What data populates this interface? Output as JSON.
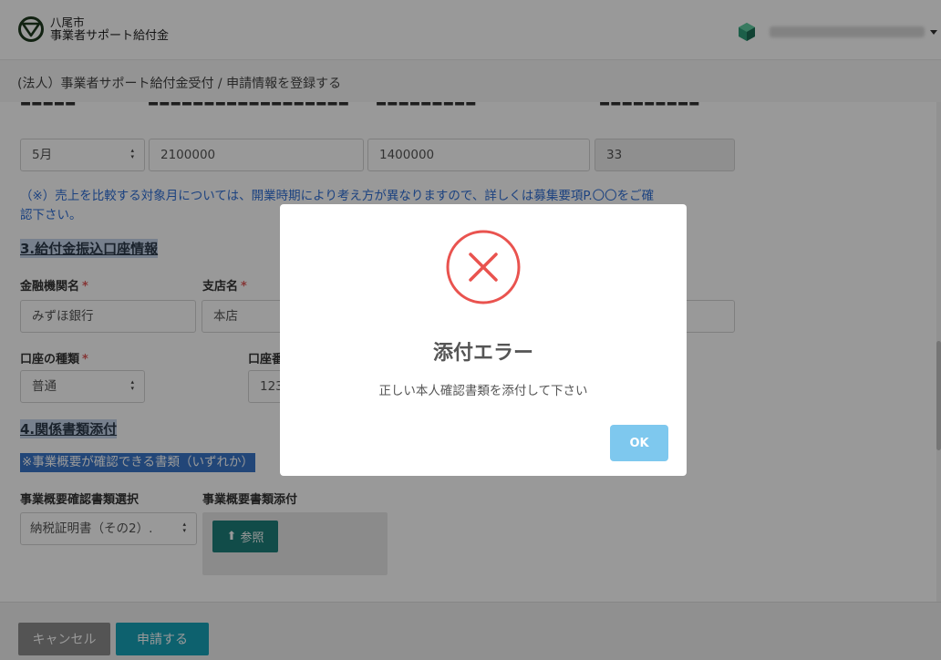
{
  "header": {
    "logo_line1": "八尾市",
    "logo_line2": "事業者サポート給付金"
  },
  "breadcrumb": "(法人）事業者サポート給付金受付 / 申請情報を登録する",
  "sales": {
    "month": "5月",
    "prior_sales": "2100000",
    "current_sales": "1400000",
    "decrease_rate": "33"
  },
  "note1_line1": "（※）売上を比較する対象月については、開業時期により考え方が異なりますので、詳しくは募集要項P.〇〇をご確",
  "note1_line2": "認下さい。",
  "section3": {
    "title": "3.給付金振込口座情報",
    "bank_label": "金融機関名",
    "bank_value": "みずほ銀行",
    "branch_label": "支店名",
    "branch_value": "本店",
    "type_label": "口座の種類",
    "type_value": "普通",
    "number_label": "口座番",
    "number_value": "123"
  },
  "section4": {
    "title": "4.関係書類添付",
    "note": "※事業概要が確認できる書類（いずれか）",
    "doc_select_label": "事業概要確認書類選択",
    "doc_select_value": "納税証明書（その2）.",
    "doc_attach_label": "事業概要書類添付",
    "browse_label": "参照"
  },
  "footer": {
    "cancel": "キャンセル",
    "submit": "申請する"
  },
  "modal": {
    "title": "添付エラー",
    "message": "正しい本人確認書類を添付して下さい",
    "ok": "OK"
  },
  "colors": {
    "accent_teal": "#17a2b8",
    "error_red": "#e9534f",
    "ok_button": "#7ec8ee",
    "required_star": "#e05a5a",
    "note_blue": "#2f6fd6"
  },
  "icons": {
    "logo": "heart-shield-logo-icon",
    "user": "cube-avatar-icon",
    "error": "x-circle-icon",
    "upload": "upload-arrow-icon"
  }
}
